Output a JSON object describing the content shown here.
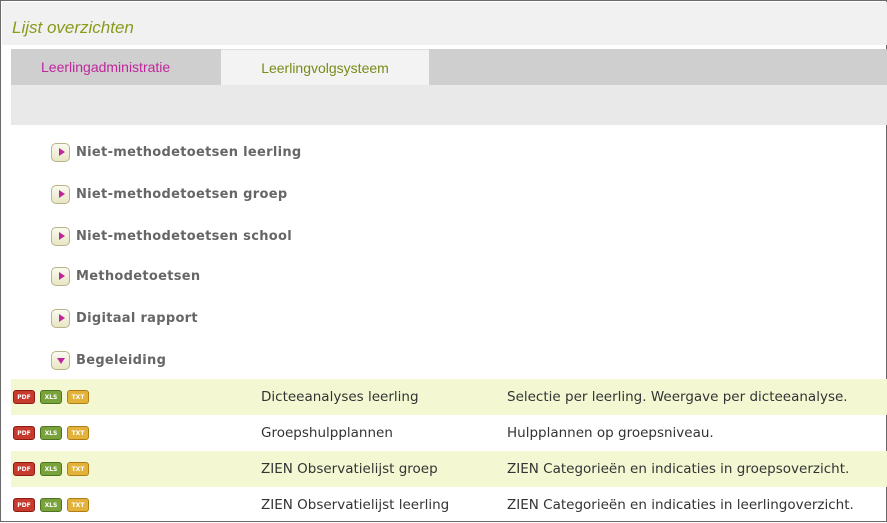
{
  "header": {
    "title": "Lijst overzichten"
  },
  "tabs": [
    {
      "label": "Leerlingadministratie",
      "active": false
    },
    {
      "label": "Leerlingvolgsysteem",
      "active": true
    }
  ],
  "categories": [
    {
      "label": "Niet-methodetoetsen leerling",
      "expanded": false
    },
    {
      "label": "Niet-methodetoetsen groep",
      "expanded": false
    },
    {
      "label": "Niet-methodetoetsen school",
      "expanded": false
    },
    {
      "label": "Methodetoetsen",
      "expanded": false
    },
    {
      "label": "Digitaal rapport",
      "expanded": false
    },
    {
      "label": "Begeleiding",
      "expanded": true
    }
  ],
  "icon_labels": {
    "pdf": "PDF",
    "xls": "XLS",
    "txt": "TXT"
  },
  "reports": [
    {
      "name": "Dicteeanalyses leerling",
      "description": "Selectie per leerling. Weergave per dicteeanalyse."
    },
    {
      "name": "Groepshulpplannen",
      "description": "Hulpplannen op groepsniveau."
    },
    {
      "name": "ZIEN Observatielijst groep",
      "description": "ZIEN Categorieën en indicaties in groepsoverzicht."
    },
    {
      "name": "ZIEN Observatielijst leerling",
      "description": "ZIEN Categorieën en indicaties in leerlingoverzicht."
    }
  ],
  "colors": {
    "accent_green": "#8a9a1a",
    "accent_magenta": "#c0269c",
    "row_highlight": "#f3f8d3"
  }
}
